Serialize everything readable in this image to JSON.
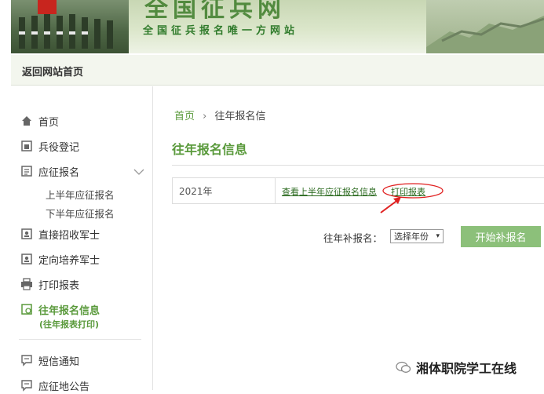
{
  "banner": {
    "title": "全国征兵网",
    "subtitle": "全国征兵报名唯一方网站"
  },
  "topnav": {
    "back_home": "返回网站首页"
  },
  "sidebar": {
    "items": [
      {
        "label": "首页",
        "icon": "home-icon"
      },
      {
        "label": "兵役登记",
        "icon": "registration-icon"
      },
      {
        "label": "应征报名",
        "icon": "form-icon"
      },
      {
        "label": "直接招收军士",
        "icon": "id-card-icon"
      },
      {
        "label": "定向培养军士",
        "icon": "id-card-icon"
      },
      {
        "label": "打印报表",
        "icon": "printer-icon"
      },
      {
        "label": "往年报名信息",
        "icon": "history-icon"
      },
      {
        "label": "短信通知",
        "icon": "message-icon"
      },
      {
        "label": "应征地公告",
        "icon": "notice-icon"
      }
    ],
    "sub_items": [
      "上半年应征报名",
      "下半年应征报名"
    ],
    "active_sub": "(往年报表打印)"
  },
  "breadcrumb": {
    "home": "首页",
    "separator": "›",
    "current": "往年报名信"
  },
  "main": {
    "title": "往年报名信息",
    "record": {
      "year": "2021年",
      "view_link": "查看上半年应征报名信息",
      "print_link": "打印报表"
    },
    "makeup": {
      "label": "往年补报名：",
      "select_value": "选择年份",
      "button": "开始补报名"
    }
  },
  "watermark": {
    "text": "湘体职院学工在线"
  },
  "colors": {
    "accent": "#5a9a3c",
    "button": "#8cc07a",
    "annotation": "#e02020"
  }
}
